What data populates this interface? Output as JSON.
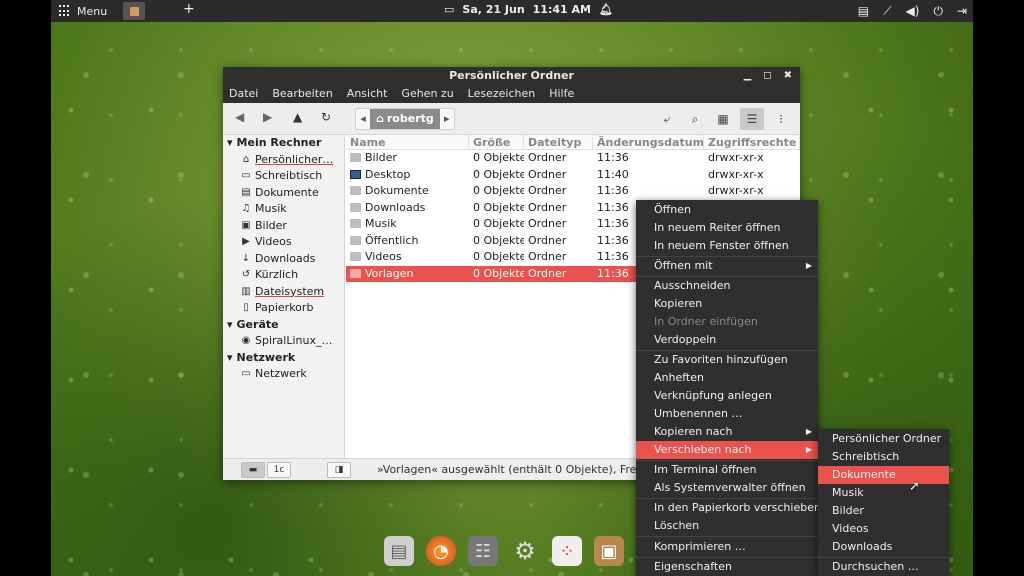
{
  "top_panel": {
    "menu_label": "Menu",
    "plus_icon": "+",
    "date": "Sa, 21 Jun",
    "time": "11:41 AM"
  },
  "window": {
    "title": "Persönlicher Ordner",
    "menubar": [
      "Datei",
      "Bearbeiten",
      "Ansicht",
      "Gehen zu",
      "Lesezeichen",
      "Hilfe"
    ],
    "path_segment": "robertg"
  },
  "sidebar": {
    "sections": [
      {
        "label": "Mein Rechner",
        "items": [
          {
            "label": "Persönlicher…",
            "icon": "home-icon",
            "glyph": "⌂"
          },
          {
            "label": "Schreibtisch",
            "icon": "desktop-icon",
            "glyph": "▭"
          },
          {
            "label": "Dokumente",
            "icon": "document-icon",
            "glyph": "▤"
          },
          {
            "label": "Musik",
            "icon": "music-icon",
            "glyph": "♫"
          },
          {
            "label": "Bilder",
            "icon": "image-icon",
            "glyph": "▣"
          },
          {
            "label": "Videos",
            "icon": "video-icon",
            "glyph": "▶"
          },
          {
            "label": "Downloads",
            "icon": "download-icon",
            "glyph": "↓"
          },
          {
            "label": "Kürzlich",
            "icon": "history-icon",
            "glyph": "↺"
          },
          {
            "label": "Dateisystem",
            "icon": "filesystem-icon",
            "glyph": "▥"
          },
          {
            "label": "Papierkorb",
            "icon": "trash-icon",
            "glyph": "▯"
          }
        ]
      },
      {
        "label": "Geräte",
        "items": [
          {
            "label": "SpiralLinux_…",
            "icon": "disc-icon",
            "glyph": "◉"
          }
        ]
      },
      {
        "label": "Netzwerk",
        "items": [
          {
            "label": "Netzwerk",
            "icon": "network-icon",
            "glyph": "▭"
          }
        ]
      }
    ]
  },
  "filelist": {
    "columns": [
      "Name",
      "Größe",
      "Dateityp",
      "Änderungsdatum",
      "Zugriffsrechte"
    ],
    "rows": [
      {
        "name": "Bilder",
        "size": "0 Objekte",
        "type": "Ordner",
        "date": "11:36",
        "perm": "drwxr-xr-x"
      },
      {
        "name": "Desktop",
        "size": "0 Objekte",
        "type": "Ordner",
        "date": "11:40",
        "perm": "drwxr-xr-x"
      },
      {
        "name": "Dokumente",
        "size": "0 Objekte",
        "type": "Ordner",
        "date": "11:36",
        "perm": "drwxr-xr-x"
      },
      {
        "name": "Downloads",
        "size": "0 Objekte",
        "type": "Ordner",
        "date": "11:36",
        "perm": ""
      },
      {
        "name": "Musik",
        "size": "0 Objekte",
        "type": "Ordner",
        "date": "11:36",
        "perm": ""
      },
      {
        "name": "Öffentlich",
        "size": "0 Objekte",
        "type": "Ordner",
        "date": "11:36",
        "perm": ""
      },
      {
        "name": "Videos",
        "size": "0 Objekte",
        "type": "Ordner",
        "date": "11:36",
        "perm": ""
      },
      {
        "name": "Vorlagen",
        "size": "0 Objekte",
        "type": "Ordner",
        "date": "11:36",
        "perm": ""
      }
    ]
  },
  "statusbar": {
    "text": "»Vorlagen« ausgewählt (enthält 0 Objekte), Freier Speicherplatz",
    "btn2": "1c"
  },
  "context_menu": {
    "items": [
      "Öffnen",
      "In neuem Reiter öffnen",
      "In neuem Fenster öffnen",
      "Öffnen mit",
      "Ausschneiden",
      "Kopieren",
      "In Ordner einfügen",
      "Verdoppeln",
      "Zu Favoriten hinzufügen",
      "Anheften",
      "Verknüpfung anlegen",
      "Umbenennen …",
      "Kopieren nach",
      "Verschieben nach",
      "Im Terminal öffnen",
      "Als Systemverwalter öffnen",
      "In den Papierkorb verschieben",
      "Löschen",
      "Komprimieren …",
      "Eigenschaften"
    ]
  },
  "submenu": {
    "items": [
      "Persönlicher Ordner",
      "Schreibtisch",
      "Dokumente",
      "Musik",
      "Bilder",
      "Videos",
      "Downloads",
      "Durchsuchen …"
    ]
  },
  "colors": {
    "accent": "#e9524d",
    "panel": "#2f2f2f"
  }
}
